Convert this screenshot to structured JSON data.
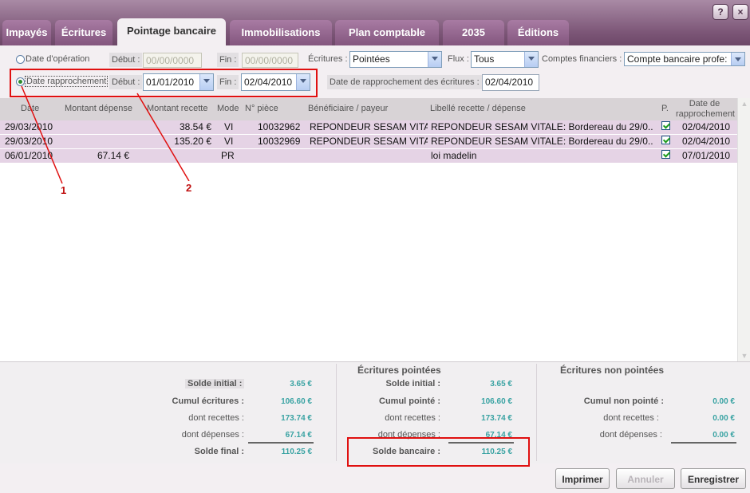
{
  "window": {
    "help_label": "?",
    "close_label": "×"
  },
  "tabs": [
    "Impayés",
    "Écritures",
    "Pointage bancaire",
    "Immobilisations",
    "Plan comptable",
    "2035",
    "Éditions"
  ],
  "filters": {
    "date_operation": {
      "label": "Date d'opération",
      "debut_label": "Début :",
      "debut_value": "00/00/0000",
      "fin_label": "Fin :",
      "fin_value": "00/00/0000",
      "selected": false
    },
    "date_rapprochement": {
      "label": "Date rapprochement",
      "debut_label": "Début :",
      "debut_value": "01/01/2010",
      "fin_label": "Fin :",
      "fin_value": "02/04/2010",
      "selected": true
    },
    "ecritures_label": "Écritures :",
    "ecritures_value": "Pointées",
    "flux_label": "Flux :",
    "flux_value": "Tous",
    "comptes_label": "Comptes financiers :",
    "comptes_value": "Compte bancaire profe:",
    "date_rappro_ecritures_label": "Date de rapprochement des écritures :",
    "date_rappro_ecritures_value": "02/04/2010"
  },
  "table": {
    "columns": [
      "Date",
      "Montant dépense",
      "Montant recette",
      "Mode",
      "N° pièce",
      "Bénéficiaire / payeur",
      "Libellé recette / dépense",
      "P.",
      "Date de rapprochement"
    ],
    "rows": [
      {
        "date": "29/03/2010",
        "depense": "",
        "recette": "38.54 €",
        "mode": "VI",
        "piece": "10032962",
        "beneficiaire": "REPONDEUR SESAM VITA",
        "libelle": "REPONDEUR SESAM VITALE: Bordereau du 29/0...",
        "pointe": true,
        "date_rappro": "02/04/2010"
      },
      {
        "date": "29/03/2010",
        "depense": "",
        "recette": "135.20 €",
        "mode": "VI",
        "piece": "10032969",
        "beneficiaire": "REPONDEUR SESAM VITA",
        "libelle": "REPONDEUR SESAM VITALE: Bordereau du 29/0...",
        "pointe": true,
        "date_rappro": "02/04/2010"
      },
      {
        "date": "06/01/2010",
        "depense": "67.14 €",
        "recette": "",
        "mode": "PR",
        "piece": "",
        "beneficiaire": "",
        "libelle": "loi madelin",
        "pointe": true,
        "date_rappro": "07/01/2010"
      }
    ]
  },
  "annotations": {
    "one": "1",
    "two": "2"
  },
  "summary": {
    "left": {
      "solde_initial_label": "Solde initial :",
      "solde_initial": "3.65 €",
      "cumul_label": "Cumul écritures :",
      "cumul": "106.60 €",
      "recettes_label": "dont recettes :",
      "recettes": "173.74 €",
      "depenses_label": "dont dépenses :",
      "depenses": "67.14 €",
      "solde_final_label": "Solde final :",
      "solde_final": "110.25 €"
    },
    "pointees": {
      "title": "Écritures pointées",
      "solde_initial_label": "Solde initial :",
      "solde_initial": "3.65 €",
      "cumul_label": "Cumul pointé :",
      "cumul": "106.60 €",
      "recettes_label": "dont recettes :",
      "recettes": "173.74 €",
      "depenses_label": "dont dépenses :",
      "depenses": "67.14 €",
      "solde_bancaire_label": "Solde bancaire :",
      "solde_bancaire": "110.25 €"
    },
    "non_pointees": {
      "title": "Écritures non pointées",
      "cumul_label": "Cumul non pointé :",
      "cumul": "0.00 €",
      "recettes_label": "dont recettes :",
      "recettes": "0.00 €",
      "depenses_label": "dont dépenses :",
      "depenses": "0.00 €"
    }
  },
  "buttons": {
    "imprimer": "Imprimer",
    "annuler": "Annuler",
    "enregistrer": "Enregistrer"
  },
  "colors": {
    "accent": "#83567e",
    "row": "#e5d3e5",
    "value": "#3aa3a3",
    "annotation": "#e01010"
  }
}
